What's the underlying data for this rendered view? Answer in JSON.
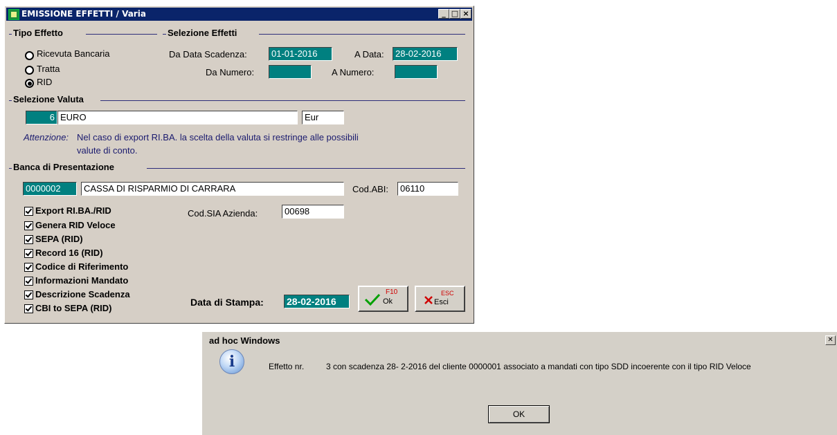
{
  "window": {
    "title": "EMISSIONE EFFETTI / Varia",
    "tipo_effetto": {
      "heading": "Tipo Effetto",
      "options": [
        "Ricevuta Bancaria",
        "Tratta",
        "RID"
      ],
      "selected": "RID"
    },
    "selezione_effetti": {
      "heading": "Selezione Effetti",
      "da_data_label": "Da Data Scadenza:",
      "da_data_value": "01-01-2016",
      "a_data_label": "A Data:",
      "a_data_value": "28-02-2016",
      "da_numero_label": "Da Numero:",
      "da_numero_value": "",
      "a_numero_label": "A Numero:",
      "a_numero_value": ""
    },
    "valuta": {
      "heading": "Selezione Valuta",
      "code": "6",
      "name": "EURO",
      "symbol": "Eur",
      "note_label": "Attenzione:",
      "note_line1": "Nel caso di export RI.BA. la scelta della valuta si restringe alle possibili",
      "note_line2": "valute di conto."
    },
    "banca": {
      "heading": "Banca di Presentazione",
      "code": "0000002",
      "name": "CASSA DI RISPARMIO DI CARRARA",
      "abi_label": "Cod.ABI:",
      "abi_value": "06110",
      "sia_label": "Cod.SIA Azienda:",
      "sia_value": "00698"
    },
    "checkboxes": [
      {
        "label": "Export RI.BA./RID",
        "checked": true
      },
      {
        "label": "Genera RID Veloce",
        "checked": true
      },
      {
        "label": "SEPA (RID)",
        "checked": true
      },
      {
        "label": "Record 16 (RID)",
        "checked": true
      },
      {
        "label": "Codice di Riferimento",
        "checked": true
      },
      {
        "label": "Informazioni Mandato",
        "checked": true
      },
      {
        "label": "Descrizione Scadenza",
        "checked": true
      },
      {
        "label": "CBI to SEPA (RID)",
        "checked": true
      }
    ],
    "data_stampa_label": "Data di Stampa:",
    "data_stampa_value": "28-02-2016",
    "ok_button": {
      "key": "F10",
      "label": "Ok"
    },
    "esci_button": {
      "key": "ESC",
      "label": "Esci"
    }
  },
  "dialog": {
    "title": "ad hoc Windows",
    "message_prefix": "Effetto nr.",
    "message_body": "3 con scadenza 28- 2-2016 del cliente 0000001 associato a mandati con tipo SDD  incoerente con il tipo RID Veloce",
    "ok_label": "OK",
    "close_glyph": "✕",
    "icon": "information-icon"
  },
  "colors": {
    "window_bg": "#d6cfc6",
    "titlebar": "#0a246a",
    "field_teal": "#008080",
    "heading_line": "#2c2c7a"
  }
}
